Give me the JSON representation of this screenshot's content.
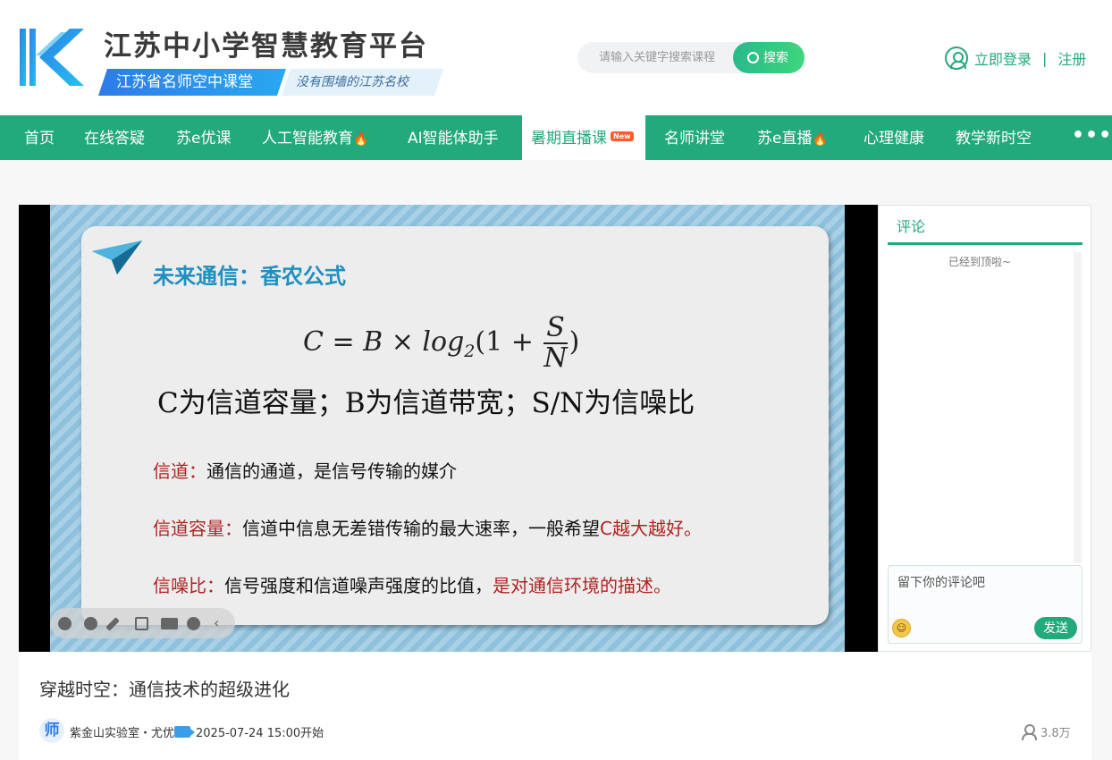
{
  "header": {
    "site_title": "江苏中小学智慧教育平台",
    "sub_left": "江苏省名师空中课堂",
    "sub_right": "没有围墙的江苏名校",
    "search_placeholder": "请输入关键字搜索课程",
    "search_button": "搜索",
    "login": "立即登录",
    "separator": "|",
    "register": "注册"
  },
  "nav": {
    "items": [
      "首页",
      "在线答疑",
      "苏e优课",
      "人工智能教育",
      "AI智能体助手",
      "暑期直播课",
      "名师讲堂",
      "苏e直播",
      "心理健康",
      "教学新时空"
    ],
    "new_badge": "New",
    "more": "•••",
    "accent": "#22a97c"
  },
  "slide": {
    "title": "未来通信：香农公式",
    "formula_left": "C = B × log",
    "formula_sub": "2",
    "formula_mid": "(1 + ",
    "formula_num": "S",
    "formula_den": "N",
    "formula_end": ")",
    "formula_desc": "C为信道容量；B为信道带宽；S/N为信噪比",
    "lines": [
      {
        "label": "信道：",
        "text": "通信的通道，是信号传输的媒介",
        "emph": ""
      },
      {
        "label": "信道容量：",
        "text": "信道中信息无差错传输的最大速率，一般希望",
        "emph": "C越大越好。"
      },
      {
        "label": "信噪比：",
        "text": "信号强度和信道噪声强度的比值，",
        "emph": "是对通信环境的描述。"
      }
    ]
  },
  "comments": {
    "tab": "评论",
    "empty": "已经到顶啦~",
    "placeholder": "留下你的评论吧",
    "send": "发送"
  },
  "course": {
    "title": "穿越时空：通信技术的超级进化",
    "avatar_text": "师",
    "teacher": "紫金山实验室・尤优",
    "start_time": "2025-07-24 15:00开始",
    "views": "3.8万"
  }
}
